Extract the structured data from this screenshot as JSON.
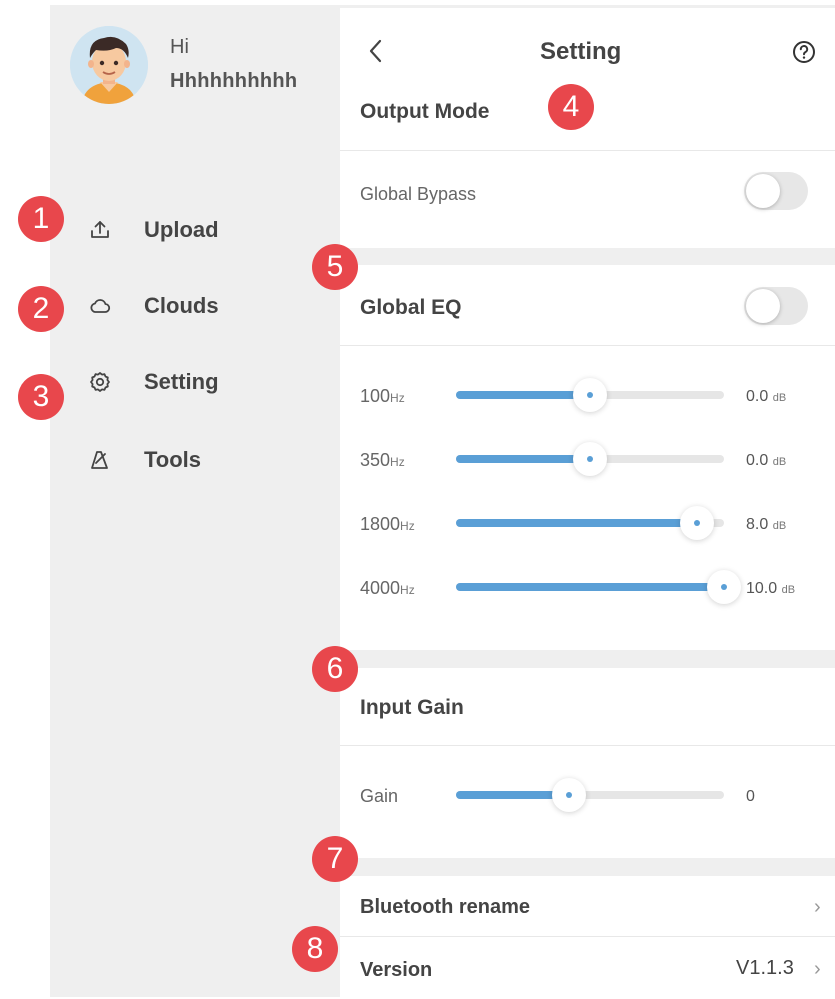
{
  "profile": {
    "greeting": "Hi",
    "username": "Hhhhhhhhhh",
    "avatar_icon": "avatar-boy"
  },
  "sidebar": {
    "items": [
      {
        "label": "Upload",
        "icon": "upload-icon"
      },
      {
        "label": "Clouds",
        "icon": "cloud-icon"
      },
      {
        "label": "Setting",
        "icon": "gear-icon"
      },
      {
        "label": "Tools",
        "icon": "metronome-icon"
      }
    ]
  },
  "markers": [
    "1",
    "2",
    "3",
    "4",
    "5",
    "6",
    "7",
    "8"
  ],
  "header": {
    "title": "Setting",
    "back_icon": "chevron-left-icon",
    "help_icon": "help-icon"
  },
  "output_mode": {
    "title": "Output Mode",
    "global_bypass_label": "Global Bypass",
    "global_bypass_on": false
  },
  "global_eq": {
    "title": "Global EQ",
    "enabled": false,
    "bands": [
      {
        "freq": "100",
        "unit": "Hz",
        "value": "0.0",
        "value_unit": "dB",
        "level": 0.5
      },
      {
        "freq": "350",
        "unit": "Hz",
        "value": "0.0",
        "value_unit": "dB",
        "level": 0.5
      },
      {
        "freq": "1800",
        "unit": "Hz",
        "value": "8.0",
        "value_unit": "dB",
        "level": 0.9
      },
      {
        "freq": "4000",
        "unit": "Hz",
        "value": "10.0",
        "value_unit": "dB",
        "level": 1.0
      }
    ]
  },
  "input_gain": {
    "title": "Input Gain",
    "gain_label": "Gain",
    "gain_value": "0",
    "level": 0.42
  },
  "bluetooth_rename": {
    "label": "Bluetooth rename",
    "chevron": "›"
  },
  "version": {
    "label": "Version",
    "value": "V1.1.3",
    "chevron": "›"
  },
  "colors": {
    "accent": "#5a9fd6",
    "marker": "#e8474c",
    "sidebar_bg": "#efefef"
  }
}
